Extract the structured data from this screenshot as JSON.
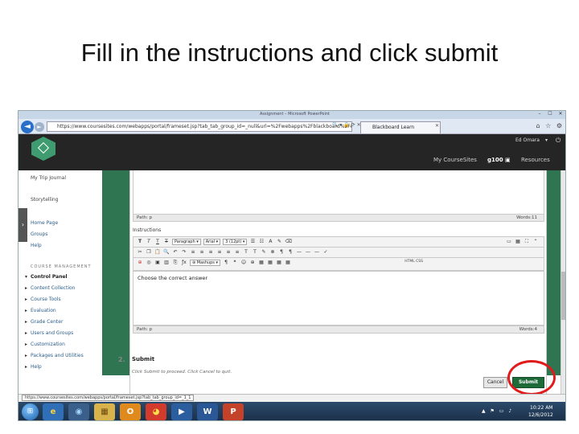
{
  "slide": {
    "title": "Fill in the instructions and click submit"
  },
  "window": {
    "title_tiny": "Assignment – Microsoft PowerPoint",
    "controls": [
      "–",
      "☐",
      "✕"
    ]
  },
  "browser": {
    "back": "◄",
    "forward": "►",
    "url": "https://www.coursesites.com/webapps/portal/frameset.jsp?tab_tab_group_id=_null&url=%2Fwebapps%2Fblackboard%2Fexec",
    "url_icons": "🔍 ▾ 🔒 ⟳ ✕",
    "tab_label": "Blackboard Learn",
    "tab_close": "✕",
    "tools": "⌂ ☆ ⚙"
  },
  "header": {
    "user": "Ed Omara",
    "user_arrow": "▾",
    "power": "⏻",
    "nav": [
      {
        "label": "My CourseSites"
      },
      {
        "label": "g100 ▣"
      },
      {
        "label": "Resources"
      }
    ]
  },
  "sidebar": {
    "toggle": "›",
    "items": [
      {
        "label": "My Trip Journal"
      },
      {
        "label": "Storytelling"
      },
      {
        "label": "Home Page"
      },
      {
        "label": "Groups"
      },
      {
        "label": "Help"
      }
    ],
    "section": "COURSE MANAGEMENT",
    "management": [
      {
        "label": "Control Panel"
      },
      {
        "label": "Content Collection"
      },
      {
        "label": "Course Tools"
      },
      {
        "label": "Evaluation"
      },
      {
        "label": "Grade Center"
      },
      {
        "label": "Users and Groups"
      },
      {
        "label": "Customization"
      },
      {
        "label": "Packages and Utilities"
      },
      {
        "label": "Help"
      }
    ]
  },
  "editor1": {
    "path": "Path: p",
    "words": "Words:11"
  },
  "instructions": {
    "label": "Instructions",
    "row1": {
      "buttons": [
        "T",
        "T",
        "T",
        "T"
      ],
      "format": "Paragraph",
      "font": "Arial",
      "size": "3 (12pt)",
      "right": [
        "▭",
        "▦",
        "⛶",
        "⌃"
      ]
    },
    "row2": {
      "buttons": [
        "✂",
        "❐",
        "📋",
        "🔍",
        "↶",
        "↷",
        "≡",
        "≡",
        "≡",
        "≡",
        "≡",
        "≡",
        "T",
        "T",
        "✎",
        "⊗",
        "¶",
        "¶",
        "—",
        "—",
        "—",
        "✓"
      ]
    },
    "row3": {
      "buttons": [
        "⊕",
        "◎",
        "▣",
        "▥",
        "⎘",
        "ƒx"
      ],
      "mashup": "Mashups",
      "more": [
        "¶",
        "❝",
        "☺",
        "⊕",
        "▦",
        "▦",
        "▦",
        "▦"
      ],
      "html": "HTML CSS"
    },
    "content": "Choose the correct answer",
    "path": "Path: p",
    "words": "Words:4"
  },
  "submit_section": {
    "number": "2.",
    "title": "Submit",
    "description": "Click Submit to proceed. Click Cancel to quit.",
    "cancel_label": "Cancel",
    "submit_label": "Submit"
  },
  "status": {
    "url": "https://www.coursesites.com/webapps/portal/frameset.jsp?tab_tab_group_id=_1_1"
  },
  "taskbar": {
    "start": "⊞",
    "apps": [
      {
        "name": "ie",
        "glyph": "e",
        "bg": "#2f6fb7",
        "fg": "#ffd23c"
      },
      {
        "name": "explorer",
        "glyph": "◉",
        "bg": "#3a5f8a",
        "fg": "#9fd4ff"
      },
      {
        "name": "files",
        "glyph": "▦",
        "bg": "#d8b24a",
        "fg": "#6b4b0f"
      },
      {
        "name": "outlook",
        "glyph": "O",
        "bg": "#e08a1e",
        "fg": "#ffffff"
      },
      {
        "name": "chrome",
        "glyph": "◕",
        "bg": "#d33b2c",
        "fg": "#ffe14d"
      },
      {
        "name": "media",
        "glyph": "▶",
        "bg": "#2b5e9f",
        "fg": "#ffffff"
      },
      {
        "name": "word",
        "glyph": "W",
        "bg": "#2b5797",
        "fg": "#ffffff"
      },
      {
        "name": "powerpoint",
        "glyph": "P",
        "bg": "#c5422a",
        "fg": "#ffffff"
      }
    ],
    "tray": "▲ ⚑ ▭ ♪",
    "time": "10:22 AM",
    "date": "12/6/2012"
  },
  "colors": {
    "accent_green": "#1e6b3a",
    "header_dark": "#252525",
    "highlight_red": "#e01b1b"
  }
}
